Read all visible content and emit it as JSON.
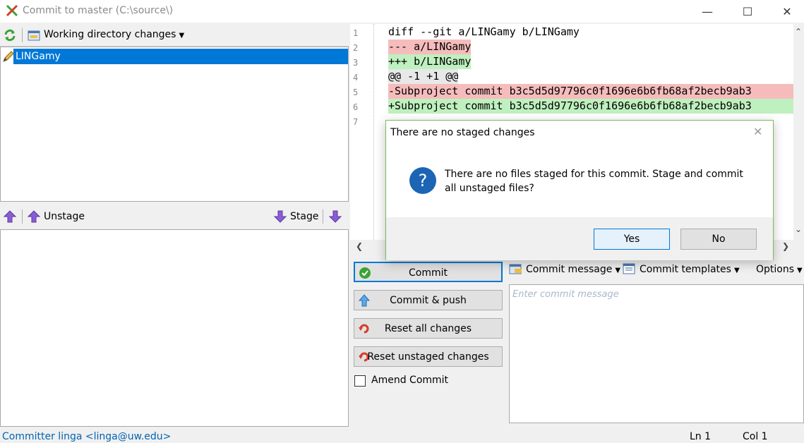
{
  "window": {
    "title": "Commit to master (C:\\source\\)"
  },
  "left_toolbar": {
    "working_dir_label": "Working directory changes"
  },
  "unstaged_files": [
    {
      "name": "LINGamy",
      "icon": "pencil-icon"
    }
  ],
  "stage_bar": {
    "unstage_label": "Unstage",
    "stage_label": "Stage"
  },
  "diff": {
    "line_numbers": [
      "1",
      "2",
      "3",
      "4",
      "5",
      "6",
      "7"
    ],
    "lines": [
      {
        "text": "diff --git a/LINGamy b/LINGamy",
        "kind": "header"
      },
      {
        "text": "--- a/LINGamy",
        "kind": "del"
      },
      {
        "text": "+++ b/LINGamy",
        "kind": "add"
      },
      {
        "text": "@@ -1 +1 @@",
        "kind": "hunk"
      },
      {
        "text": "-Subproject commit b3c5d5d97796c0f1696e6b6fb68af2becb9ab3",
        "kind": "del"
      },
      {
        "text": "+Subproject commit b3c5d5d97796c0f1696e6b6fb68af2becb9ab3",
        "kind": "add"
      },
      {
        "text": "",
        "kind": "context"
      }
    ]
  },
  "actions": {
    "commit": "Commit",
    "commit_push": "Commit & push",
    "reset_all": "Reset all changes",
    "reset_unstaged": "Reset unstaged changes",
    "amend": "Amend Commit"
  },
  "message_toolbar": {
    "commit_message": "Commit message",
    "commit_templates": "Commit templates",
    "options": "Options"
  },
  "message_box": {
    "placeholder": "Enter commit message"
  },
  "status": {
    "committer": "Committer linga <linga@uw.edu>",
    "ln": "Ln 1",
    "col": "Col 1"
  },
  "dialog": {
    "title": "There are no staged changes",
    "message": "There are no files staged for this commit. Stage and commit all unstaged files?",
    "yes": "Yes",
    "no": "No"
  },
  "colors": {
    "selection": "#0078d7",
    "del_bg": "#f6bcbc",
    "add_bg": "#bff0bf"
  }
}
